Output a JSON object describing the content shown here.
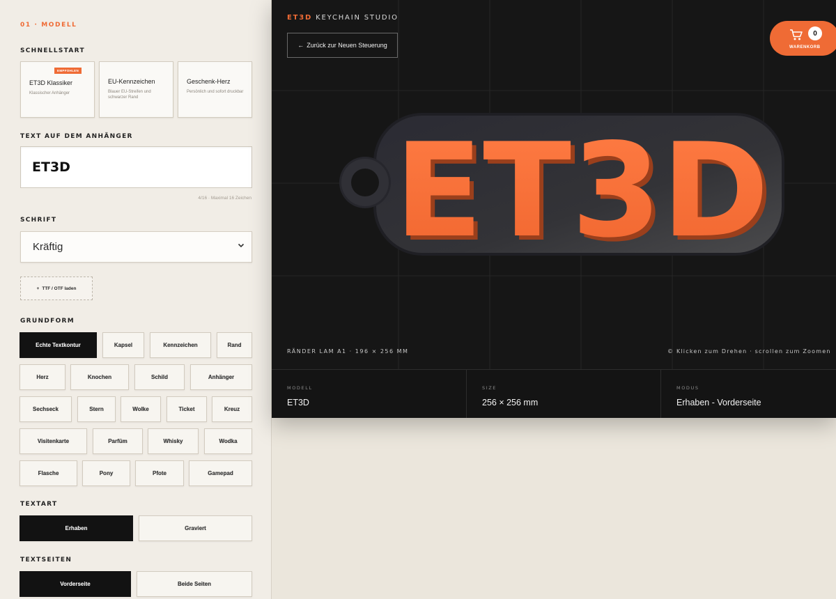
{
  "sidebar": {
    "step_label": "01 · MODELL",
    "quickstart": {
      "heading": "SCHNELLSTART",
      "presets": [
        {
          "title": "ET3D Klassiker",
          "subtitle": "Klassischer Anhänger",
          "badge": "EMPFOHLEN"
        },
        {
          "title": "EU-Kennzeichen",
          "subtitle": "Blauer EU-Streifen und schwarzer Rand",
          "badge": ""
        },
        {
          "title": "Geschenk-Herz",
          "subtitle": "Persönlich und sofort druckbar",
          "badge": ""
        }
      ]
    },
    "text": {
      "heading": "TEXT AUF DEM ANHÄNGER",
      "value": "ET3D",
      "counter": "4/16 · Maximal 16 Zeichen"
    },
    "font": {
      "heading": "SCHRIFT",
      "selected": "Kräftig",
      "upload_label": "TTF / OTF laden"
    },
    "shape": {
      "heading": "GRUNDFORM",
      "options": [
        "Echte Textkontur",
        "Kapsel",
        "Kennzeichen",
        "Rand",
        "Herz",
        "Knochen",
        "Schild",
        "Anhänger",
        "Sechseck",
        "Stern",
        "Wolke",
        "Ticket",
        "Kreuz",
        "Visitenkarte",
        "Parfüm",
        "Whisky",
        "Wodka",
        "Flasche",
        "Pony",
        "Pfote",
        "Gamepad"
      ],
      "selected": "Echte Textkontur"
    },
    "text_style": {
      "heading": "TEXTART",
      "options": [
        "Erhaben",
        "Graviert"
      ],
      "selected": "Erhaben"
    },
    "text_sides": {
      "heading": "TEXTSEITEN",
      "options": [
        "Vorderseite",
        "Beide Seiten"
      ],
      "selected": "Vorderseite"
    }
  },
  "preview": {
    "brand_accent": "ET3D",
    "brand_rest": "KEYCHAIN STUDIO",
    "back_label": "Zurück zur Neuen Steuerung",
    "cart": {
      "count": "0",
      "label": "WARENKORB"
    },
    "model_text": "ET3D",
    "dims_text": "RÄNDER LAM A1 · 196 × 256 MM",
    "hint_text": "© Klicken zum Drehen · scrollen zum Zoomen",
    "info": [
      {
        "label": "MODELL",
        "value": "ET3D"
      },
      {
        "label": "SIZE",
        "value": "256 × 256 mm"
      },
      {
        "label": "MODUS",
        "value": "Erhaben - Vorderseite"
      }
    ]
  },
  "colors": {
    "accent": "#ef6b35",
    "dark": "#121212",
    "panel": "#f1ede6",
    "preview_bg": "#161616",
    "plate": "#2c2c30"
  },
  "icons": [
    "arrow-left-icon",
    "cart-icon",
    "plus-icon",
    "chevron-down-icon"
  ]
}
